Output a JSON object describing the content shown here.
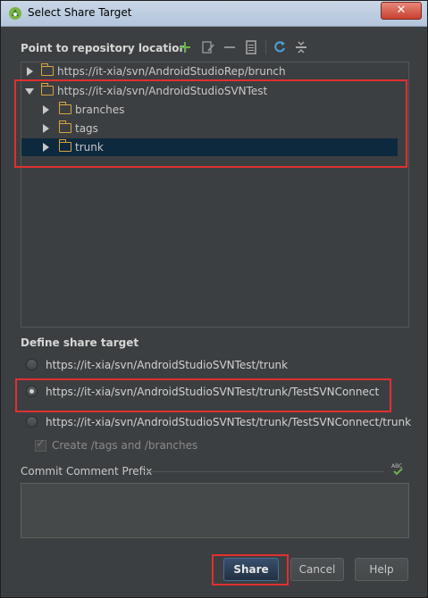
{
  "window": {
    "title": "Select Share Target",
    "close_label": "✕"
  },
  "repository": {
    "header": "Point to repository location",
    "toolbar": {
      "add_icon": "plus-icon",
      "edit_icon": "edit-icon",
      "remove_icon": "minus-icon",
      "browse_icon": "document-icon",
      "refresh_icon": "refresh-icon",
      "collapse_icon": "collapse-icon",
      "add_color": "#6ab04c",
      "refresh_color": "#4aa3df"
    },
    "tree": [
      {
        "label": "https://it-xia/svn/AndroidStudioRep/brunch",
        "expanded": false,
        "level": 0
      },
      {
        "label": "https://it-xia/svn/AndroidStudioSVNTest",
        "expanded": true,
        "level": 0
      },
      {
        "label": "branches",
        "expanded": false,
        "level": 1
      },
      {
        "label": "tags",
        "expanded": false,
        "level": 1
      },
      {
        "label": "trunk",
        "expanded": false,
        "level": 1,
        "selected": true
      }
    ]
  },
  "share_target": {
    "header": "Define share target",
    "options": [
      {
        "label": "https://it-xia/svn/AndroidStudioSVNTest/trunk",
        "checked": false
      },
      {
        "label": "https://it-xia/svn/AndroidStudioSVNTest/trunk/TestSVNConnect",
        "checked": true
      },
      {
        "label": "https://it-xia/svn/AndroidStudioSVNTest/trunk/TestSVNConnect/trunk",
        "checked": false
      }
    ],
    "create_tags_label": "Create /tags and /branches",
    "create_tags_checked": true
  },
  "commit": {
    "label": "Commit Comment Prefix",
    "spellcheck_icon": "spellcheck-icon",
    "value": ""
  },
  "buttons": {
    "share": "Share",
    "cancel": "Cancel",
    "help": "Help"
  },
  "colors": {
    "highlight_box": "#e03030",
    "selection_bg": "#0d293e",
    "folder": "#d9a441"
  }
}
